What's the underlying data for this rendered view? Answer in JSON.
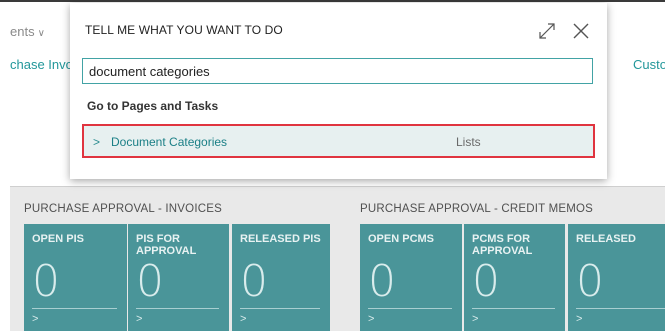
{
  "background": {
    "nav_item": "ents",
    "nav_chevron": "∨",
    "link_left": "chase Invo",
    "link_right": "Customer"
  },
  "sections": [
    {
      "title": "PURCHASE APPROVAL - INVOICES"
    },
    {
      "title": "PURCHASE APPROVAL - CREDIT MEMOS"
    }
  ],
  "tiles": [
    {
      "label": "OPEN PIS",
      "value": "0",
      "arrow": ">"
    },
    {
      "label": "PIS FOR APPROVAL",
      "value": "0",
      "arrow": ">"
    },
    {
      "label": "RELEASED PIS",
      "value": "0",
      "arrow": ">"
    },
    {
      "label": "OPEN PCMS",
      "value": "0",
      "arrow": ">"
    },
    {
      "label": "PCMS FOR APPROVAL",
      "value": "0",
      "arrow": ">"
    },
    {
      "label": "RELEASED",
      "value": "0",
      "arrow": ">"
    }
  ],
  "dialog": {
    "title": "TELL ME WHAT YOU WANT TO DO",
    "search_value": "document categories",
    "group_heading": "Go to Pages and Tasks",
    "results": [
      {
        "chevron": ">",
        "name": "Document Categories",
        "type": "Lists"
      }
    ]
  },
  "colors": {
    "accent": "#22979a",
    "tile": "#4a9599",
    "highlight_border": "#e0343f",
    "result_bg": "#e7f0f0"
  }
}
